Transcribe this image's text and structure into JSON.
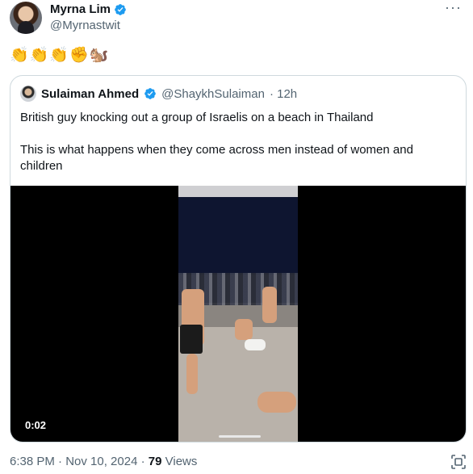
{
  "author": {
    "name": "Myrna Lim",
    "handle": "@Myrnastwit"
  },
  "menu": {
    "more_label": "···"
  },
  "post": {
    "text": "👏👏👏✊🐿️"
  },
  "quoted": {
    "name": "Sulaiman Ahmed",
    "handle": "@ShaykhSulaiman",
    "time": "· 12h",
    "line1": "British guy knocking out a group of Israelis on a beach in Thailand",
    "line2": "This is what happens when they come across men instead of women and children",
    "video": {
      "duration": "0:02"
    }
  },
  "meta": {
    "timestamp": "6:38 PM · Nov 10, 2024 ·",
    "views_count": "79",
    "views_label": "Views"
  },
  "colors": {
    "verified": "#1d9bf0",
    "secondary_text": "#536471",
    "border": "#cfd9de"
  },
  "icons": [
    "verified-badge-icon",
    "more-icon",
    "scan-icon"
  ]
}
